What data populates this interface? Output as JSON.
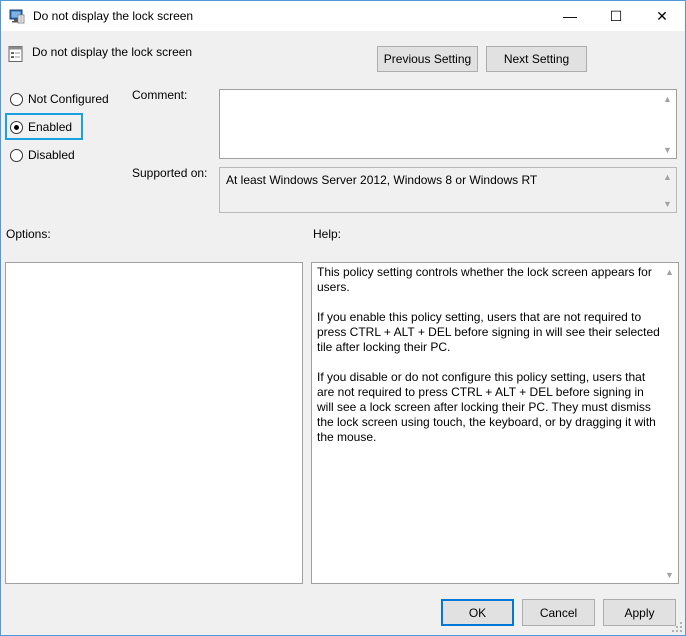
{
  "window": {
    "title": "Do not display the lock screen",
    "min_glyph": "—",
    "max_glyph": "☐",
    "close_glyph": "✕"
  },
  "header": {
    "setting_name": "Do not display the lock screen"
  },
  "nav": {
    "previous_label": "Previous Setting",
    "next_label": "Next Setting"
  },
  "state": {
    "options": [
      {
        "label": "Not Configured",
        "selected": false
      },
      {
        "label": "Enabled",
        "selected": true
      },
      {
        "label": "Disabled",
        "selected": false
      }
    ]
  },
  "comment": {
    "label": "Comment:",
    "value": ""
  },
  "supported": {
    "label": "Supported on:",
    "value": "At least Windows Server 2012, Windows 8 or Windows RT"
  },
  "options_panel": {
    "label": "Options:"
  },
  "help_panel": {
    "label": "Help:",
    "paragraphs": [
      "This policy setting controls whether the lock screen appears for users.",
      "If you enable this policy setting, users that are not required to press CTRL + ALT + DEL before signing in will see their selected tile after  locking their PC.",
      "If you disable or do not configure this policy setting, users that are not required to press CTRL + ALT + DEL before signing in will see a lock screen after locking their PC. They must dismiss the lock screen using touch, the keyboard, or by dragging it with the mouse."
    ]
  },
  "footer": {
    "ok_label": "OK",
    "cancel_label": "Cancel",
    "apply_label": "Apply"
  },
  "colors": {
    "focus": "#1ba1e2",
    "default_button_border": "#0078d7",
    "window_border": "#4c9adb"
  }
}
